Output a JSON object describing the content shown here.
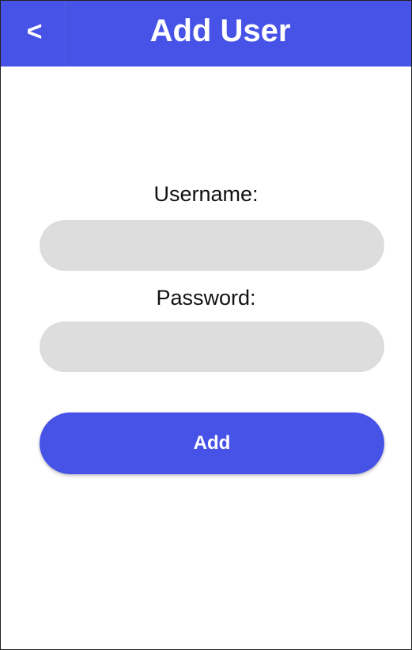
{
  "header": {
    "back_label": "<",
    "title": "Add User"
  },
  "form": {
    "username_label": "Username:",
    "username_value": "",
    "password_label": "Password:",
    "password_value": "",
    "submit_label": "Add"
  },
  "colors": {
    "primary": "#4753e6",
    "input_background": "#dddddd",
    "text": "#111111"
  },
  "icons": {
    "back": "chevron-left-icon"
  }
}
